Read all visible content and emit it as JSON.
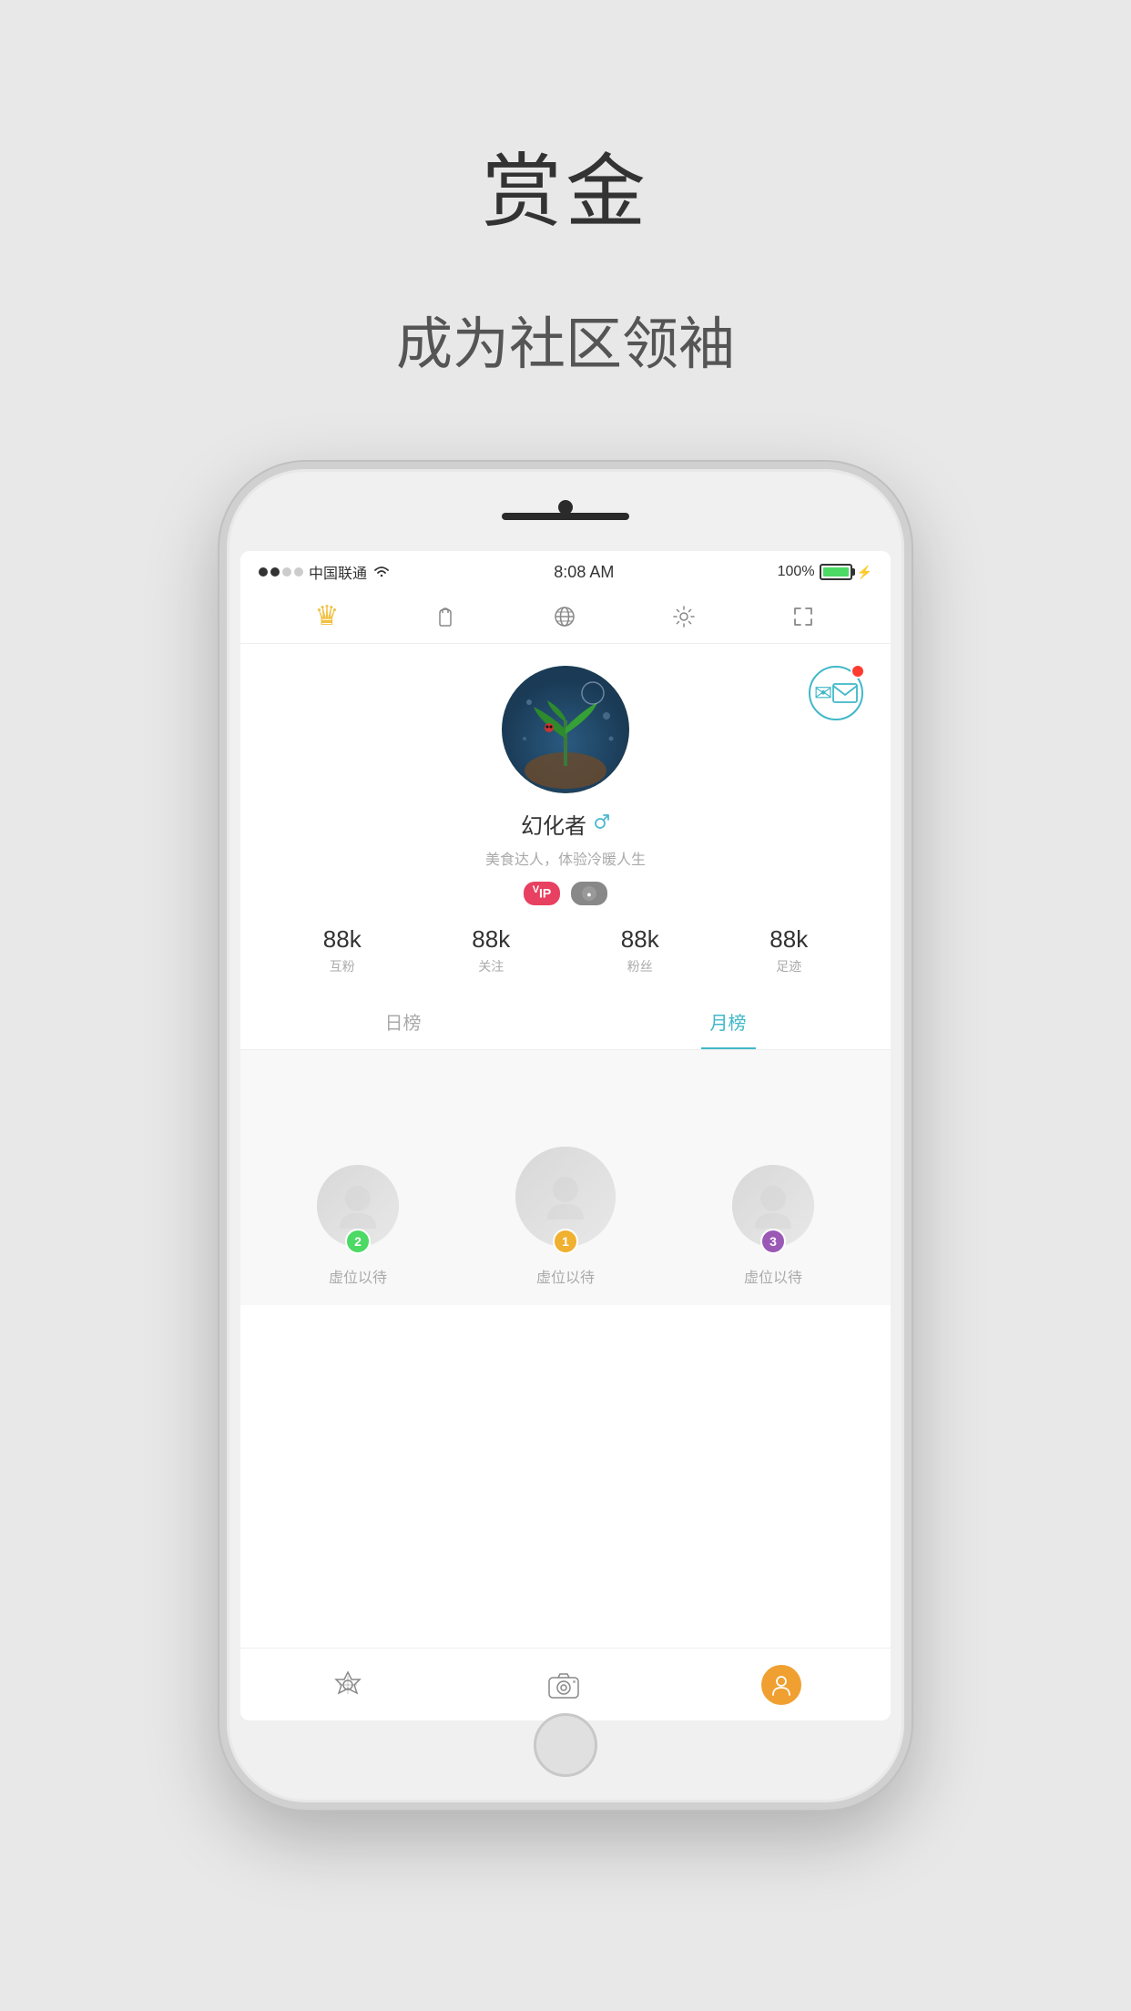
{
  "page": {
    "bg_title": "赏金",
    "bg_subtitle": "成为社区领袖"
  },
  "status_bar": {
    "carrier": "中国联通",
    "time": "8:08 AM",
    "battery_percent": "100%"
  },
  "nav_icons": [
    {
      "name": "crown",
      "label": "crown-nav",
      "icon": "👑"
    },
    {
      "name": "bag",
      "label": "bag-nav",
      "icon": "👜"
    },
    {
      "name": "globe",
      "label": "globe-nav",
      "icon": "🌐"
    },
    {
      "name": "settings",
      "label": "settings-nav",
      "icon": "⚙️"
    },
    {
      "name": "scan",
      "label": "scan-nav",
      "icon": "▣"
    }
  ],
  "profile": {
    "username": "幻化者",
    "bio": "美食达人，体验冷暖人生",
    "badges": [
      "VIP",
      "●"
    ],
    "stats": [
      {
        "num": "88k",
        "label": "互粉"
      },
      {
        "num": "88k",
        "label": "关注"
      },
      {
        "num": "88k",
        "label": "粉丝"
      },
      {
        "num": "88k",
        "label": "足迹"
      }
    ]
  },
  "tabs": [
    {
      "label": "日榜",
      "active": false
    },
    {
      "label": "月榜",
      "active": true
    }
  ],
  "ranking": [
    {
      "position": 2,
      "name": "虚位以待",
      "badge_color": "green",
      "badge_num": "2"
    },
    {
      "position": 1,
      "name": "虚位以待",
      "badge_color": "gold",
      "badge_num": "1"
    },
    {
      "position": 3,
      "name": "虚位以待",
      "badge_color": "purple",
      "badge_num": "3"
    }
  ],
  "bottom_tabs": [
    {
      "name": "home",
      "icon_type": "star-triangle"
    },
    {
      "name": "camera",
      "icon_type": "camera"
    },
    {
      "name": "profile",
      "icon_type": "person"
    }
  ]
}
